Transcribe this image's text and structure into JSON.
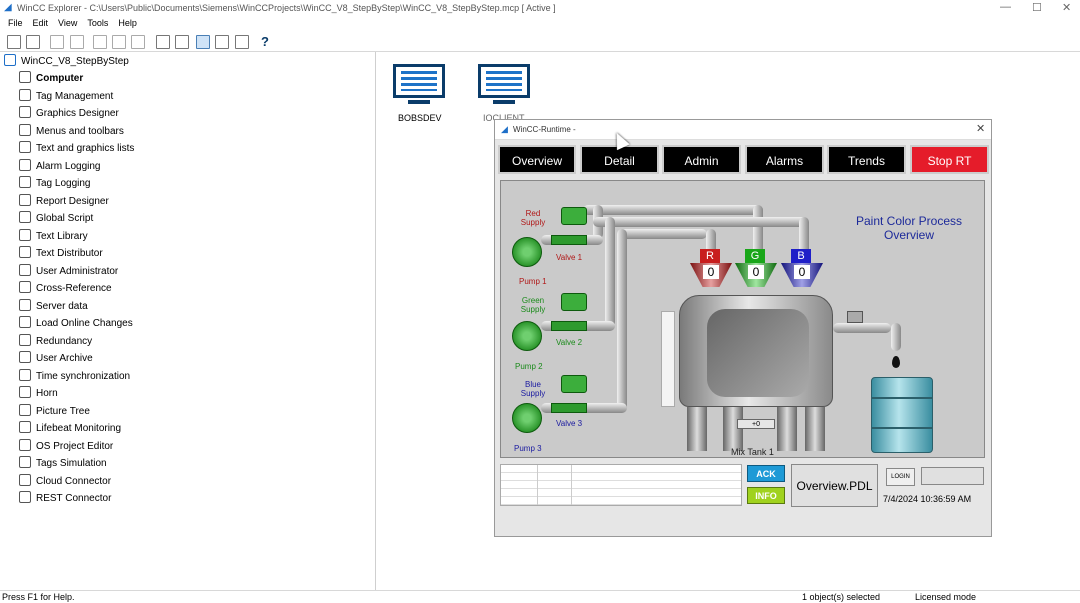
{
  "window": {
    "title": "WinCC Explorer - C:\\Users\\Public\\Documents\\Siemens\\WinCCProjects\\WinCC_V8_StepByStep\\WinCC_V8_StepByStep.mcp [ Active ]"
  },
  "menu": [
    "File",
    "Edit",
    "View",
    "Tools",
    "Help"
  ],
  "tree": {
    "root": "WinCC_V8_StepByStep",
    "items": [
      {
        "label": "Computer",
        "icon": "computer-icon",
        "bold": true
      },
      {
        "label": "Tag Management",
        "icon": "tag-management-icon"
      },
      {
        "label": "Graphics Designer",
        "icon": "graphics-designer-icon"
      },
      {
        "label": "Menus and toolbars",
        "icon": "menus-toolbars-icon"
      },
      {
        "label": "Text and graphics lists",
        "icon": "text-graphics-lists-icon"
      },
      {
        "label": "Alarm Logging",
        "icon": "alarm-bell-icon"
      },
      {
        "label": "Tag Logging",
        "icon": "tag-logging-icon"
      },
      {
        "label": "Report Designer",
        "icon": "report-designer-icon"
      },
      {
        "label": "Global Script",
        "icon": "global-script-icon"
      },
      {
        "label": "Text Library",
        "icon": "text-library-icon"
      },
      {
        "label": "Text Distributor",
        "icon": "text-distributor-icon"
      },
      {
        "label": "User Administrator",
        "icon": "user-administrator-icon"
      },
      {
        "label": "Cross-Reference",
        "icon": "cross-reference-icon"
      },
      {
        "label": "Server data",
        "icon": "server-data-icon"
      },
      {
        "label": "Load Online Changes",
        "icon": "load-online-changes-icon"
      },
      {
        "label": "Redundancy",
        "icon": "redundancy-icon"
      },
      {
        "label": "User Archive",
        "icon": "user-archive-icon"
      },
      {
        "label": "Time synchronization",
        "icon": "time-sync-icon"
      },
      {
        "label": "Horn",
        "icon": "horn-icon"
      },
      {
        "label": "Picture Tree",
        "icon": "picture-tree-icon"
      },
      {
        "label": "Lifebeat Monitoring",
        "icon": "lifebeat-icon"
      },
      {
        "label": "OS Project Editor",
        "icon": "os-project-editor-icon"
      },
      {
        "label": "Tags Simulation",
        "icon": "tags-simulation-icon"
      },
      {
        "label": "Cloud Connector",
        "icon": "cloud-connector-icon"
      },
      {
        "label": "REST Connector",
        "icon": "rest-connector-icon"
      }
    ]
  },
  "computers": [
    "BOBSDEV",
    "IOCLIENT"
  ],
  "runtime": {
    "title": "WinCC-Runtime -",
    "nav": [
      "Overview",
      "Detail",
      "Admin",
      "Alarms",
      "Trends",
      "Stop RT"
    ],
    "process_title": "Paint Color Process Overview",
    "supplies": [
      {
        "supply": "Red Supply",
        "valve": "Valve 1",
        "pump": "Pump 1",
        "color": "#b01818"
      },
      {
        "supply": "Green Supply",
        "valve": "Valve 2",
        "pump": "Pump 2",
        "color": "#1a8a1a"
      },
      {
        "supply": "Blue Supply",
        "valve": "Valve 3",
        "pump": "Pump 3",
        "color": "#1a1aa0"
      }
    ],
    "hoppers": [
      {
        "letter": "R",
        "value": "0",
        "color": "#c81e1e"
      },
      {
        "letter": "G",
        "value": "0",
        "color": "#19a619"
      },
      {
        "letter": "B",
        "value": "0",
        "color": "#1e1ec8"
      }
    ],
    "tank_label": "Mix Tank 1",
    "tank_value": "+0",
    "ack_label": "ACK",
    "info_label": "INFO",
    "picture_name": "Overview.PDL",
    "login_label": "LOGIN",
    "datetime": "7/4/2024 10:36:59 AM"
  },
  "status": {
    "help": "Press F1 for Help.",
    "selected": "1 object(s) selected",
    "mode": "Licensed mode"
  }
}
